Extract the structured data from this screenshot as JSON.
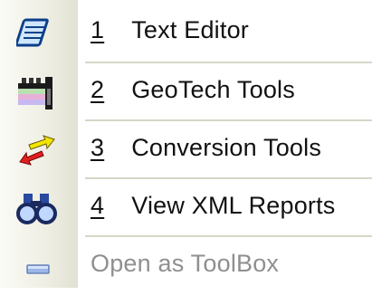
{
  "menu": {
    "items": [
      {
        "accel": "1",
        "text": "Text Editor",
        "icon": "notepad-icon"
      },
      {
        "accel": "2",
        "text": "GeoTech Tools",
        "icon": "geotech-icon"
      },
      {
        "accel": "3",
        "text": "Conversion Tools",
        "icon": "conversion-arrows-icon"
      },
      {
        "accel": "4",
        "text": "View XML Reports",
        "icon": "binoculars-icon"
      }
    ],
    "toolbox": {
      "text": "Open as ToolBox",
      "icon": "toolbox-icon",
      "enabled": false
    }
  }
}
